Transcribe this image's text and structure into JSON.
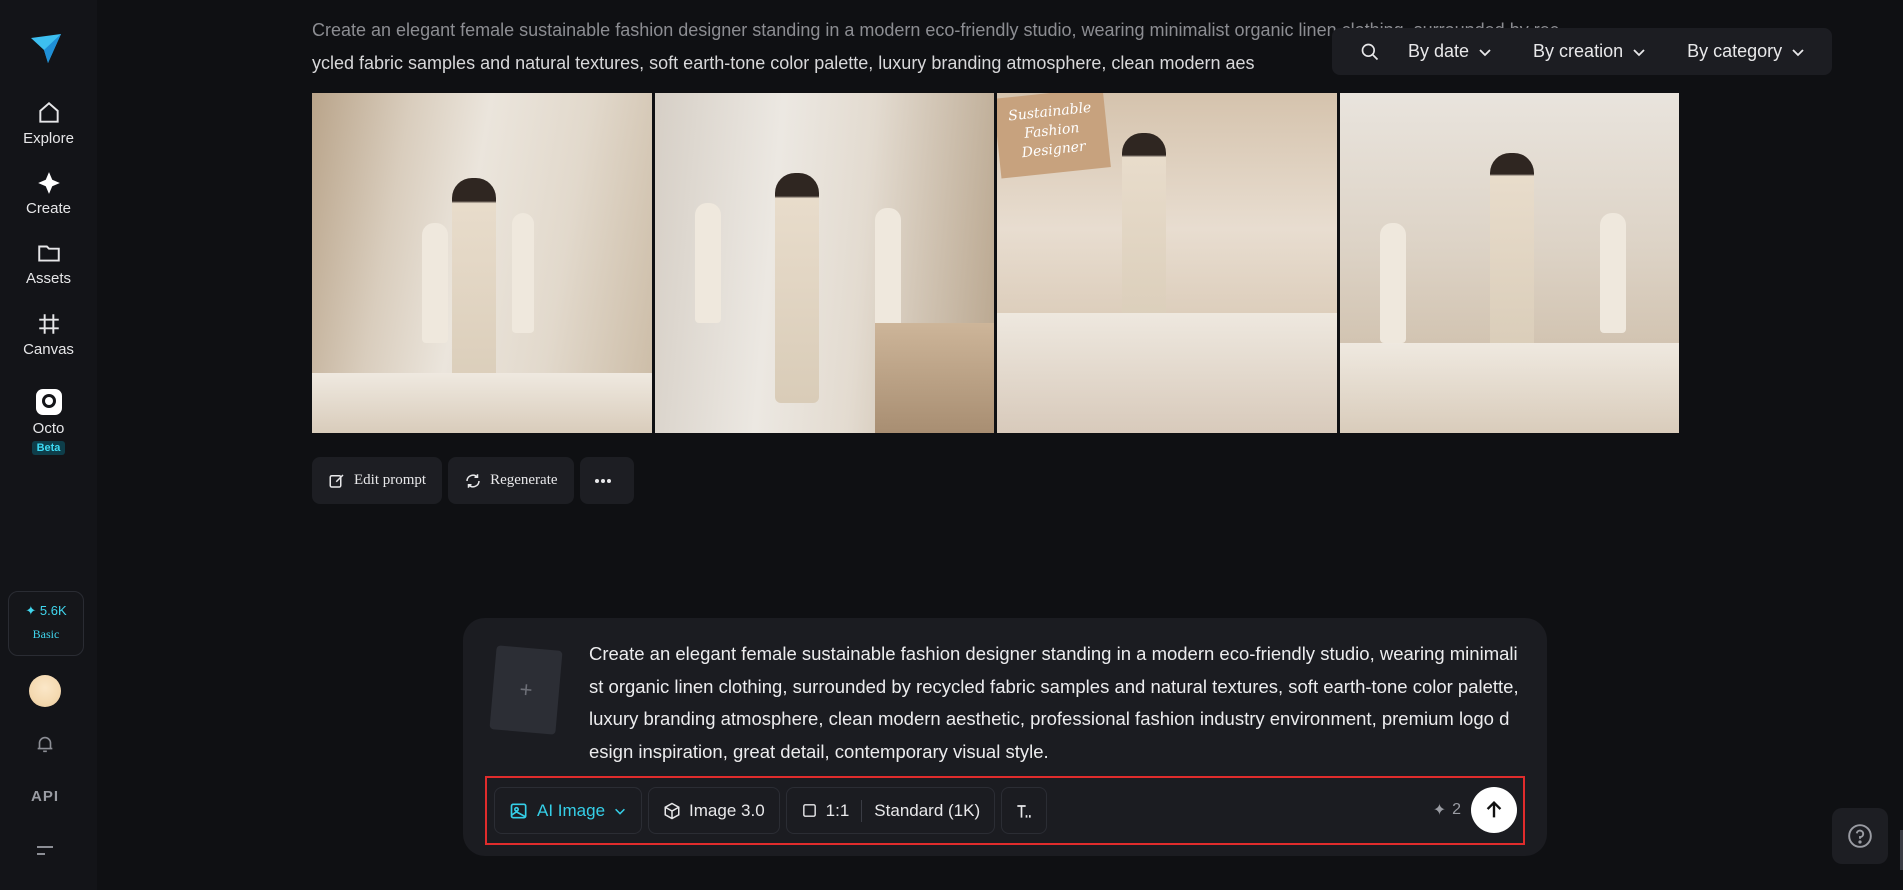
{
  "sidebar": {
    "items": [
      {
        "label": "Explore",
        "icon": "home-icon"
      },
      {
        "label": "Create",
        "icon": "sparkle-icon"
      },
      {
        "label": "Assets",
        "icon": "folder-icon"
      },
      {
        "label": "Canvas",
        "icon": "canvas-icon"
      },
      {
        "label": "Octo",
        "icon": "octo-icon",
        "badge": "Beta"
      }
    ],
    "credits": {
      "value": "5.6K",
      "plan": "Basic"
    },
    "api_label": "API"
  },
  "prompt_header": {
    "line1": "Create an elegant female sustainable fashion designer standing in a modern eco-friendly studio, wearing minimalist organic linen clothing, surrounded by rec",
    "line2": "ycled fabric samples and natural textures, soft earth-tone color palette, luxury branding atmosphere, clean modern aes"
  },
  "filters": {
    "date": "By date",
    "creation": "By creation",
    "category": "By category"
  },
  "gallery": {
    "box_text": "Sustainable Fashion Designer"
  },
  "actions": {
    "edit": "Edit prompt",
    "regenerate": "Regenerate"
  },
  "composer": {
    "text": "Create an elegant female sustainable fashion designer standing in a modern eco-friendly studio, wearing minimalist organic linen clothing, surrounded by recycled fabric samples and natural textures, soft earth-tone color palette, luxury branding atmosphere, clean modern aesthetic, professional fashion industry environment, premium logo design inspiration, great detail, contemporary visual style.",
    "mode": "AI Image",
    "model": "Image 3.0",
    "ratio": "1:1",
    "quality": "Standard (1K)",
    "cost": "2"
  },
  "colors": {
    "accent": "#35cfe8",
    "highlight_border": "#e02c2c"
  }
}
